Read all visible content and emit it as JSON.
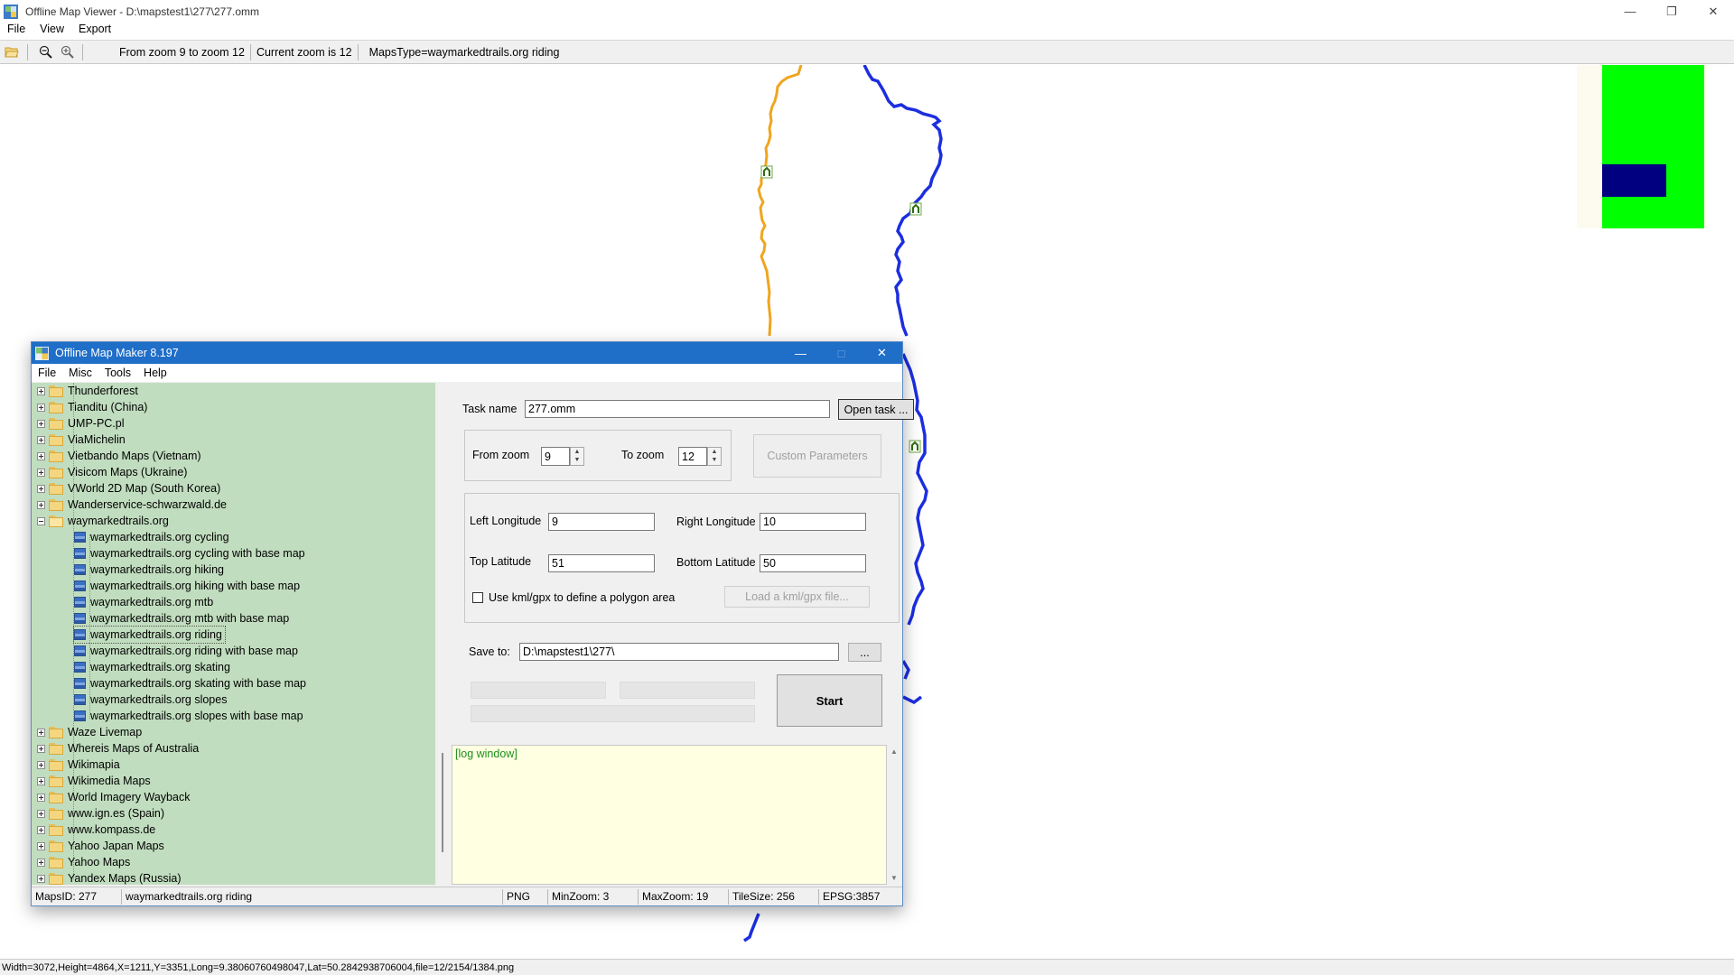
{
  "viewer": {
    "title": "Offline Map Viewer - D:\\mapstest1\\277\\277.omm",
    "menu": [
      "File",
      "View",
      "Export"
    ],
    "toolbar": {
      "zoom_range": "From zoom 9 to zoom 12",
      "current_zoom": "Current zoom is 12",
      "maps_type": "MapsType=waymarkedtrails.org riding"
    },
    "status": "Width=3072,Height=4864,X=1211,Y=3351,Long=9.38060760498047,Lat=50.2842938706004,file=12/2154/1384.png",
    "colors": {
      "route_orange": "#f0a51e",
      "route_blue": "#1c2ee0",
      "overview_green": "#00ff00",
      "overview_navy": "#000080"
    }
  },
  "maker": {
    "title": "Offline Map Maker 8.197",
    "menu": [
      "File",
      "Misc",
      "Tools",
      "Help"
    ],
    "tree": {
      "top_items": [
        "Thunderforest",
        "Tianditu (China)",
        "UMP-PC.pl",
        "ViaMichelin",
        "Vietbando Maps (Vietnam)",
        "Visicom Maps (Ukraine)",
        "VWorld 2D Map (South Korea)",
        "Wanderservice-schwarzwald.de"
      ],
      "expanded_folder": "waymarkedtrails.org",
      "children": [
        "waymarkedtrails.org cycling",
        "waymarkedtrails.org cycling with base map",
        "waymarkedtrails.org hiking",
        "waymarkedtrails.org hiking with base map",
        "waymarkedtrails.org mtb",
        "waymarkedtrails.org mtb with base map",
        "waymarkedtrails.org riding",
        "waymarkedtrails.org riding with base map",
        "waymarkedtrails.org skating",
        "waymarkedtrails.org skating with base map",
        "waymarkedtrails.org slopes",
        "waymarkedtrails.org slopes with base map"
      ],
      "selected_child": "waymarkedtrails.org riding",
      "bottom_items": [
        "Waze Livemap",
        "Whereis Maps of Australia",
        "Wikimapia",
        "Wikimedia Maps",
        "World Imagery Wayback",
        "www.ign.es (Spain)",
        "www.kompass.de",
        "Yahoo Japan Maps",
        "Yahoo Maps",
        "Yandex Maps (Russia)"
      ]
    },
    "task": {
      "label": "Task name",
      "value": "277.omm",
      "open_button": "Open task ..."
    },
    "zoom": {
      "from_label": "From zoom",
      "from_value": "9",
      "to_label": "To zoom",
      "to_value": "12",
      "custom_button": "Custom Parameters"
    },
    "coords": {
      "left_lon_label": "Left Longitude",
      "left_lon": "9",
      "right_lon_label": "Right Longitude",
      "right_lon": "10",
      "top_lat_label": "Top Latitude",
      "top_lat": "51",
      "bottom_lat_label": "Bottom Latitude",
      "bottom_lat": "50",
      "kml_checkbox_label": "Use kml/gpx to define a polygon area",
      "kml_checked": false,
      "load_kml_button": "Load a kml/gpx file..."
    },
    "save": {
      "label": "Save to:",
      "value": "D:\\mapstest1\\277\\",
      "browse_button": "...",
      "start_button": "Start"
    },
    "log": {
      "text": "[log window]"
    },
    "status": {
      "maps_id": "MapsID: 277",
      "maps_name": "waymarkedtrails.org riding",
      "format": "PNG",
      "min_zoom": "MinZoom: 3",
      "max_zoom": "MaxZoom: 19",
      "tile_size": "TileSize: 256",
      "epsg": "EPSG:3857"
    }
  }
}
